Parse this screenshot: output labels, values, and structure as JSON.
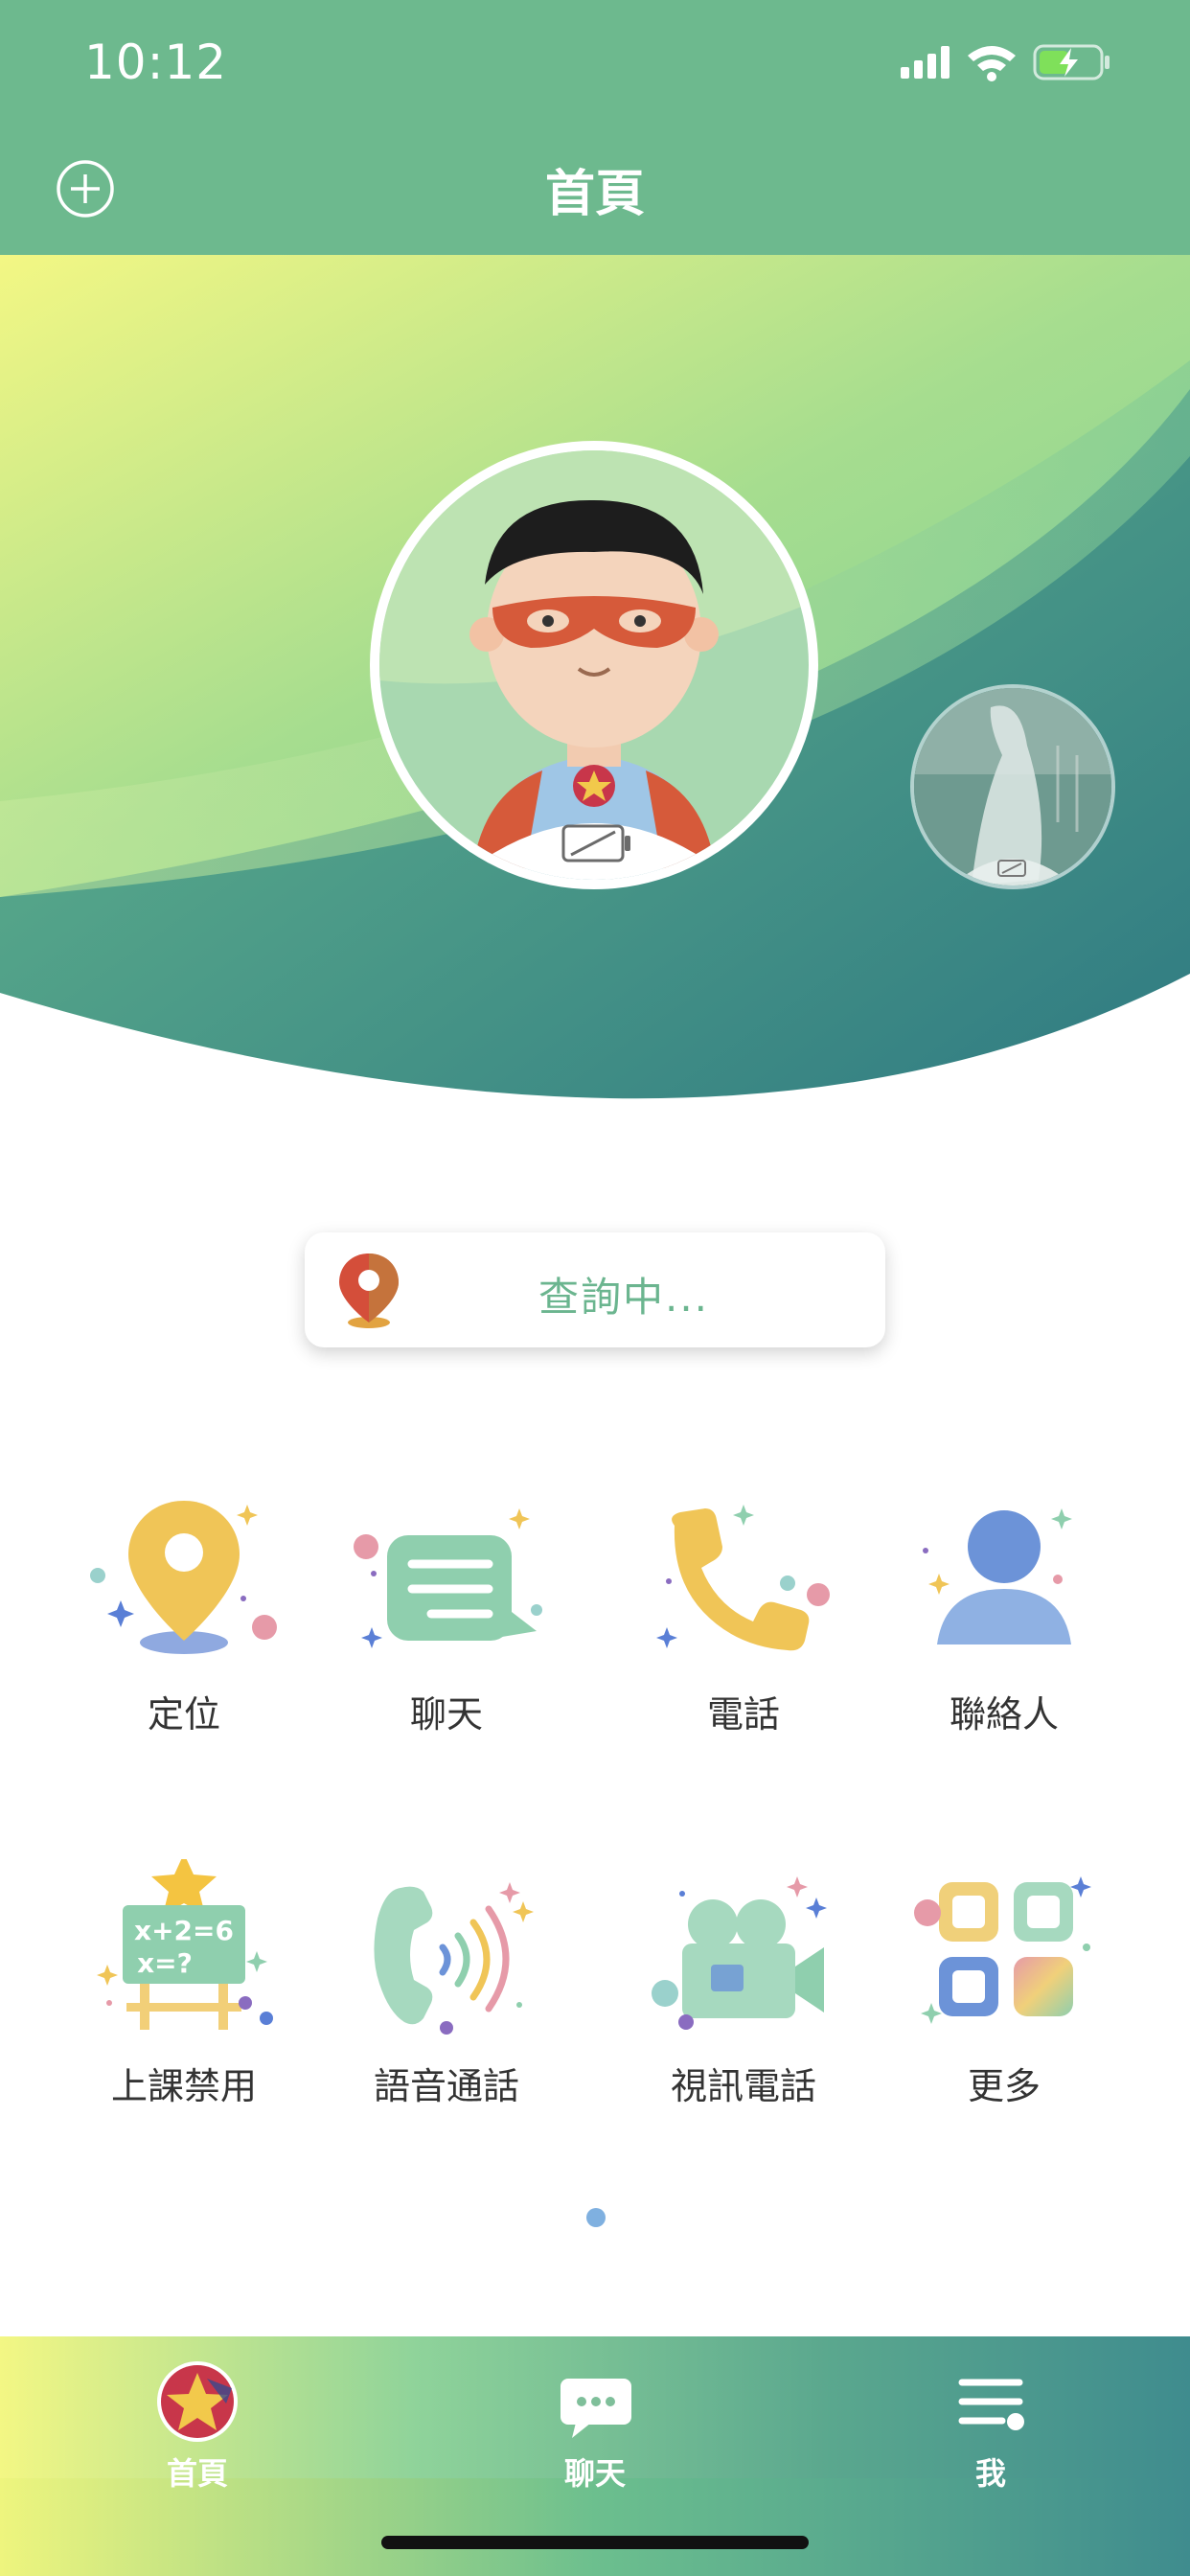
{
  "status_bar": {
    "time": "10:12"
  },
  "header": {
    "title": "首頁"
  },
  "location": {
    "status_text": "查詢中..."
  },
  "features": [
    {
      "label": "定位",
      "icon": "location-pin-icon"
    },
    {
      "label": "聊天",
      "icon": "chat-bubble-icon"
    },
    {
      "label": "電話",
      "icon": "phone-icon"
    },
    {
      "label": "聯絡人",
      "icon": "contact-icon"
    },
    {
      "label": "上課禁用",
      "icon": "class-board-icon",
      "board_text": [
        "x+2=6",
        "x=?"
      ]
    },
    {
      "label": "語音通話",
      "icon": "voice-call-icon"
    },
    {
      "label": "視訊電話",
      "icon": "video-call-icon"
    },
    {
      "label": "更多",
      "icon": "more-grid-icon"
    }
  ],
  "tabbar": {
    "items": [
      {
        "label": "首頁",
        "icon": "home-star-icon"
      },
      {
        "label": "聊天",
        "icon": "chat-icon"
      },
      {
        "label": "我",
        "icon": "menu-icon"
      }
    ]
  },
  "colors": {
    "primary_green": "#6db98e",
    "accent_yellow": "#f0c14b",
    "teal": "#3f8c8e"
  }
}
